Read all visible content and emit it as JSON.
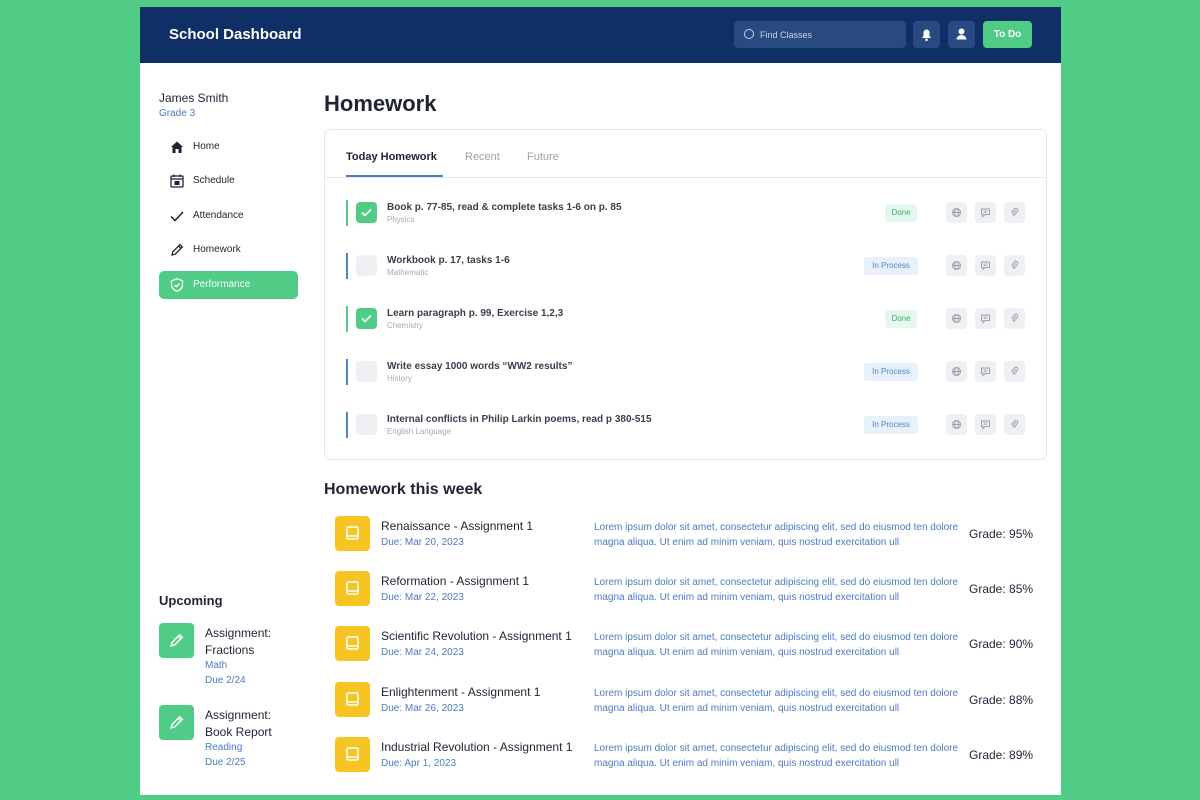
{
  "header": {
    "app_title": "School Dashboard",
    "search_placeholder": "Find Classes",
    "todo_label": "To Do",
    "icons": [
      "search-icon",
      "bell-icon",
      "user-icon"
    ]
  },
  "user": {
    "name": "James Smith",
    "grade": "Grade 3"
  },
  "nav": [
    {
      "label": "Home",
      "icon": "home-icon",
      "active": false
    },
    {
      "label": "Schedule",
      "icon": "calendar-icon",
      "active": false
    },
    {
      "label": "Attendance",
      "icon": "check-icon",
      "active": false
    },
    {
      "label": "Homework",
      "icon": "pencil-icon",
      "active": false
    },
    {
      "label": "Performance",
      "icon": "shield-check-icon",
      "active": true
    }
  ],
  "upcoming": {
    "title": "Upcoming",
    "items": [
      {
        "title": "Assignment: Fractions",
        "subject": "Math",
        "due": "Due 2/24",
        "icon": "pencil-icon"
      },
      {
        "title": "Assignment: Book Report",
        "subject": "Reading",
        "due": "Due 2/25",
        "icon": "pencil-icon"
      }
    ]
  },
  "homework": {
    "title": "Homework",
    "tabs": [
      {
        "label": "Today Homework",
        "active": true
      },
      {
        "label": "Recent",
        "active": false
      },
      {
        "label": "Future",
        "active": false
      }
    ],
    "items": [
      {
        "title": "Book p. 77-85, read & complete tasks 1-6 on p. 85",
        "subject": "Physics",
        "status": "Done",
        "checked": true
      },
      {
        "title": "Workbook p. 17, tasks 1-6",
        "subject": "Mathematic",
        "status": "In Process",
        "checked": false
      },
      {
        "title": "Learn paragraph p. 99, Exercise 1,2,3",
        "subject": "Chemistry",
        "status": "Done",
        "checked": true
      },
      {
        "title": "Write essay 1000 words “WW2 results”",
        "subject": "History",
        "status": "In Process",
        "checked": false
      },
      {
        "title": "Internal conflicts in Philip Larkin poems, read p 380-515",
        "subject": "English Language",
        "status": "In Process",
        "checked": false
      }
    ],
    "action_icons": [
      "globe-icon",
      "comment-icon",
      "paperclip-icon"
    ]
  },
  "week": {
    "title": "Homework this week",
    "items": [
      {
        "title": "Renaissance - Assignment 1",
        "due": "Due: Mar 20, 2023",
        "desc": "Lorem ipsum dolor sit amet, consectetur adipiscing elit, sed do eiusmod  ten dolore magna aliqua. Ut enim ad minim  veniam, quis nostrud exercitation ull",
        "grade": "Grade: 95%"
      },
      {
        "title": "Reformation - Assignment 1",
        "due": "Due: Mar 22, 2023",
        "desc": "Lorem ipsum dolor sit amet, consectetur adipiscing elit, sed do eiusmod  ten dolore magna aliqua. Ut enim ad minim  veniam, quis nostrud exercitation ull",
        "grade": "Grade: 85%"
      },
      {
        "title": "Scientific Revolution - Assignment 1",
        "due": "Due: Mar 24, 2023",
        "desc": "Lorem ipsum dolor sit amet, consectetur adipiscing elit, sed do eiusmod  ten dolore magna aliqua. Ut enim ad minim  veniam, quis nostrud exercitation ull",
        "grade": "Grade: 90%"
      },
      {
        "title": "Enlightenment - Assignment 1",
        "due": "Due: Mar 26, 2023",
        "desc": "Lorem ipsum dolor sit amet, consectetur adipiscing elit, sed do eiusmod  ten dolore magna aliqua. Ut enim ad minim  veniam, quis nostrud exercitation ull",
        "grade": "Grade: 88%"
      },
      {
        "title": "Industrial Revolution - Assignment 1",
        "due": "Due: Apr 1, 2023",
        "desc": "Lorem ipsum dolor sit amet, consectetur adipiscing elit, sed do eiusmod  ten dolore magna aliqua. Ut enim ad minim  veniam, quis nostrud exercitation ull",
        "grade": "Grade: 89%"
      }
    ]
  },
  "colors": {
    "page_bg": "#50cc86",
    "header_bg": "#0f2f66",
    "accent_green": "#50cc86",
    "accent_blue": "#4a7cc1",
    "book_yellow": "#f6c423"
  }
}
